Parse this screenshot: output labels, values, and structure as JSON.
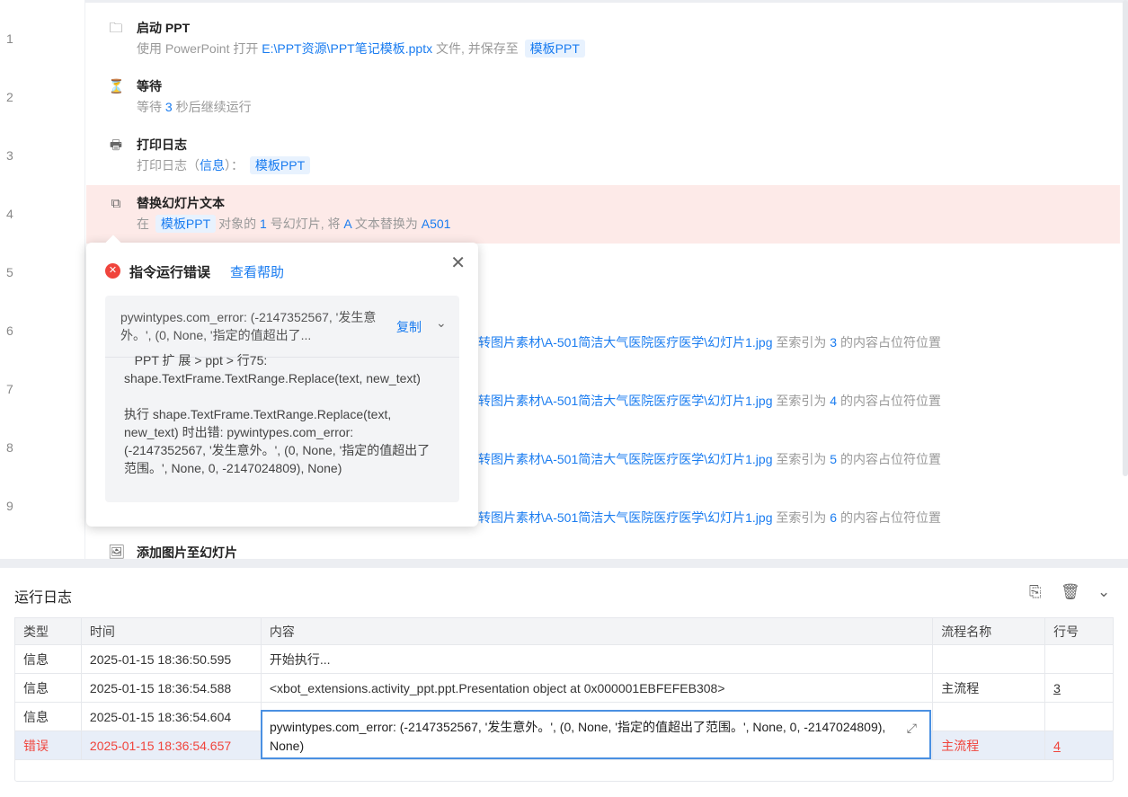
{
  "line_numbers": [
    "1",
    "2",
    "3",
    "4",
    "5",
    "6",
    "7",
    "8",
    "9"
  ],
  "steps": [
    {
      "title": "启动 PPT",
      "d1": "使用 PowerPoint 打开",
      "path": "E:\\PPT资源\\PPT笔记模板.pptx",
      "d2": "文件, 并保存至",
      "tag": "模板PPT"
    },
    {
      "title": "等待",
      "d1": "等待",
      "val": "3",
      "d2": "秒后继续运行"
    },
    {
      "title": "打印日志",
      "d1": "打印日志（",
      "val": "信息",
      "d2": "）：",
      "tag": "模板PPT"
    },
    {
      "title": "替换幻灯片文本",
      "d1": "在",
      "tag": "模板PPT",
      "d2": "对象的",
      "n": "1",
      "d3": "号幻灯片, 将",
      "a": "A",
      "d4": "文本替换为",
      "b": "A501"
    }
  ],
  "partial_rows": [
    {
      "path": "转图片素材\\A-501简洁大气医院医疗医学\\幻灯片1.jpg",
      "mid": "至索引为",
      "idx": "3",
      "end": "的内容占位符位置"
    },
    {
      "path": "转图片素材\\A-501简洁大气医院医疗医学\\幻灯片1.jpg",
      "mid": "至索引为",
      "idx": "4",
      "end": "的内容占位符位置"
    },
    {
      "path": "转图片素材\\A-501简洁大气医院医疗医学\\幻灯片1.jpg",
      "mid": "至索引为",
      "idx": "5",
      "end": "的内容占位符位置"
    },
    {
      "path": "转图片素材\\A-501简洁大气医院医疗医学\\幻灯片1.jpg",
      "mid": "至索引为",
      "idx": "6",
      "end": "的内容占位符位置"
    }
  ],
  "step9_title": "添加图片至幻灯片",
  "popup": {
    "title": "指令运行错误",
    "help": "查看帮助",
    "summary": "pywintypes.com_error: (-2147352567, '发生意外。', (0, None, '指定的值超出了...",
    "copy": "复制",
    "detail": "   PPT 扩 展 > ppt > 行75:\nshape.TextFrame.TextRange.Replace(text, new_text)\n\n执行 shape.TextFrame.TextRange.Replace(text, new_text) 时出错: pywintypes.com_error: (-2147352567, '发生意外。', (0, None, '指定的值超出了范围。', None, 0, -2147024809), None)"
  },
  "log": {
    "title": "运行日志",
    "headers": [
      "类型",
      "时间",
      "内容",
      "流程名称",
      "行号"
    ],
    "rows": [
      {
        "type": "信息",
        "time": "2025-01-15 18:36:50.595",
        "content": "开始执行...",
        "flow": "",
        "line": ""
      },
      {
        "type": "信息",
        "time": "2025-01-15 18:36:54.588",
        "content": "<xbot_extensions.activity_ppt.ppt.Presentation object at 0x000001EBFEFEB308>",
        "flow": "主流程",
        "line": "3"
      },
      {
        "type": "信息",
        "time": "2025-01-15 18:36:54.604",
        "content": "",
        "flow": "",
        "line": ""
      },
      {
        "type": "错误",
        "time": "2025-01-15 18:36:54.657",
        "content": "",
        "flow": "主流程",
        "line": "4"
      }
    ],
    "editor_text": "pywintypes.com_error: (-2147352567, '发生意外。', (0, None, '指定的值超出了范围。', None, 0, -2147024809), None)"
  }
}
